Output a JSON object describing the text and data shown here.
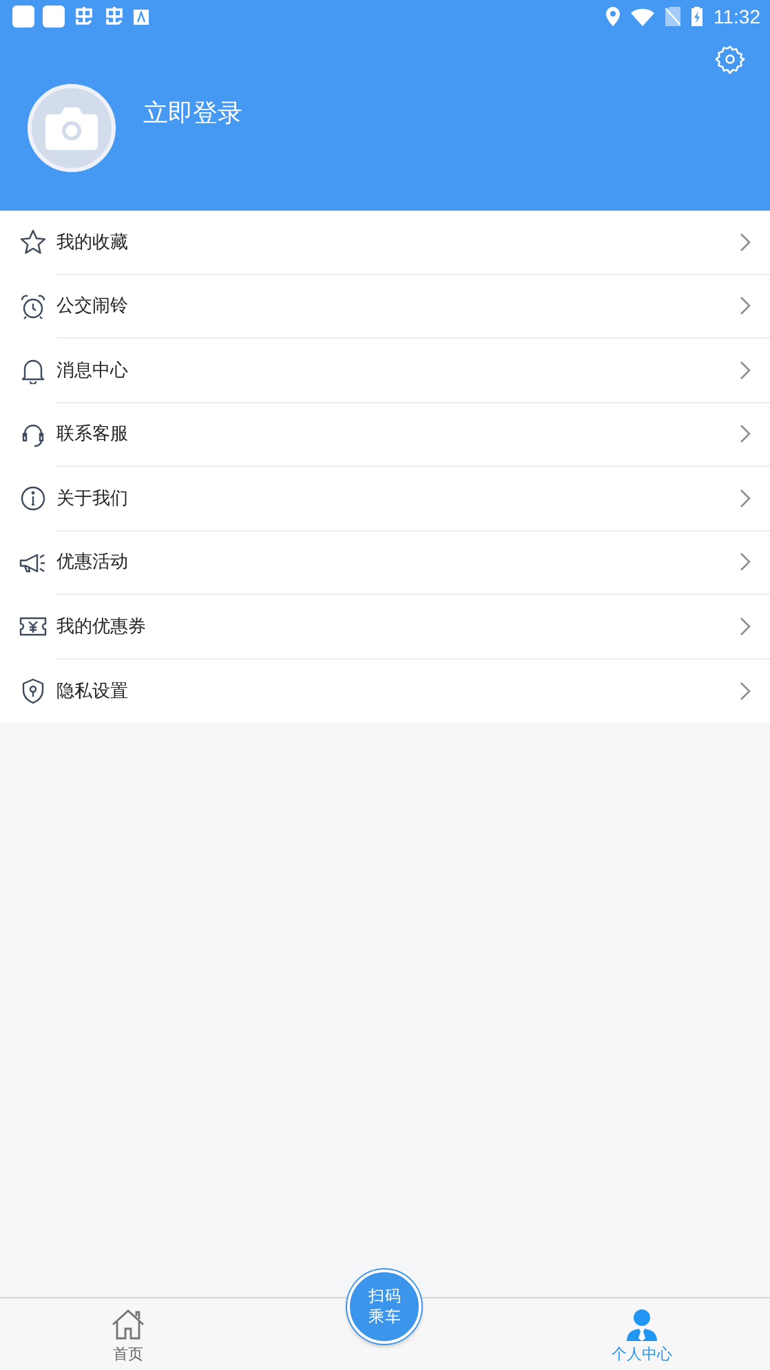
{
  "status_bar": {
    "time": "11:32"
  },
  "profile": {
    "login_label": "立即登录"
  },
  "menu": [
    {
      "label": "我的收藏",
      "kind": "star"
    },
    {
      "label": "公交闹铃",
      "kind": "alarm"
    },
    {
      "label": "消息中心",
      "kind": "bell"
    },
    {
      "label": "联系客服",
      "kind": "headset"
    },
    {
      "label": "关于我们",
      "kind": "info"
    },
    {
      "label": "优惠活动",
      "kind": "megaphone"
    },
    {
      "label": "我的优惠券",
      "kind": "coupon"
    },
    {
      "label": "隐私设置",
      "kind": "shield"
    }
  ],
  "bottom_nav": {
    "tabs": [
      {
        "label": "首页",
        "kind": "home",
        "selected": false
      },
      {
        "label": "个人中心",
        "kind": "person",
        "selected": true
      }
    ],
    "scan_button": "扫码乘车"
  }
}
